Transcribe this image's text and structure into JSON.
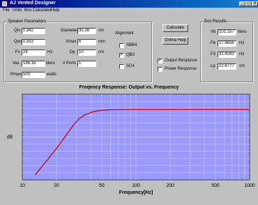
{
  "window": {
    "title": "AJ Vented Designer",
    "min_label": "_",
    "max_label": "□",
    "close_label": "×"
  },
  "menu": [
    {
      "label": "File"
    },
    {
      "label": "Units"
    },
    {
      "label": "Box Calculator"
    },
    {
      "label": "Help"
    }
  ],
  "speaker": {
    "title": "Speaker Parameters",
    "qts": {
      "label": "Qts",
      "value": "0.342"
    },
    "qes": {
      "label": "Qes",
      "value": "0.353"
    },
    "fs": {
      "label": "Fs",
      "value": "24",
      "unit": "Hz"
    },
    "vas": {
      "label": "Vas",
      "value": "186.16",
      "unit": "liters"
    },
    "pmax": {
      "label": "Pmax",
      "value": "500",
      "unit": "watts"
    },
    "diameter": {
      "label": "Diameter",
      "value": "30.38",
      "unit": "cm"
    },
    "xmax": {
      "label": "Xmax",
      "value": "6",
      "unit": "mm"
    },
    "dp": {
      "label": "Dp",
      "value": "10",
      "unit": "cm"
    },
    "ports": {
      "label": "# Ports",
      "value": "1"
    }
  },
  "alignment": {
    "title": "Alignment",
    "options": [
      {
        "label": "SBB4",
        "checked": false,
        "mark": ""
      },
      {
        "label": "QB3",
        "checked": true,
        "mark": "✓"
      },
      {
        "label": "SC4",
        "checked": false,
        "mark": ""
      }
    ]
  },
  "buttons": {
    "calculate": "Calculate",
    "online_help": "Online Help"
  },
  "options": {
    "output_response": {
      "label": "Output Response",
      "checked": true,
      "mark": "✓"
    },
    "power_response": {
      "label": "Power Response",
      "checked": false,
      "mark": ""
    }
  },
  "results": {
    "title": "Box Results",
    "vb": {
      "label": "Vb",
      "value": "101.157",
      "unit": "liters"
    },
    "fb": {
      "label": "Fb",
      "value": "27.8656",
      "unit": "Hz"
    },
    "f3": {
      "label": "F3",
      "value": "31.4291",
      "unit": "Hz"
    },
    "lp": {
      "label": "Lp",
      "value": "22.6777",
      "unit": "cm"
    }
  },
  "chart_data": {
    "type": "line",
    "title": "Freqency Response: Output vs. Frequency",
    "xlabel": "Frequency[Hz]",
    "ylabel": "dB",
    "x_scale": "log",
    "xlim": [
      10,
      1000
    ],
    "ylim": [
      -28,
      6
    ],
    "x_ticks": [
      10,
      20,
      50,
      100,
      200,
      500,
      1000
    ],
    "grid": true,
    "colors": {
      "plot_bg": "#9999ff",
      "grid": "#c8c8ff",
      "line": "#cc0000"
    },
    "series": [
      {
        "x": [
          13,
          15,
          17,
          20,
          22,
          25,
          28,
          31.4,
          35,
          40,
          45,
          50,
          60,
          80,
          100,
          200,
          500,
          1000
        ],
        "y": [
          -26,
          -22.5,
          -19.5,
          -15.5,
          -13,
          -9.5,
          -6.5,
          -3.8,
          -2.4,
          -1.3,
          -0.7,
          -0.4,
          -0.2,
          -0.1,
          0,
          0,
          0,
          0
        ]
      }
    ]
  }
}
